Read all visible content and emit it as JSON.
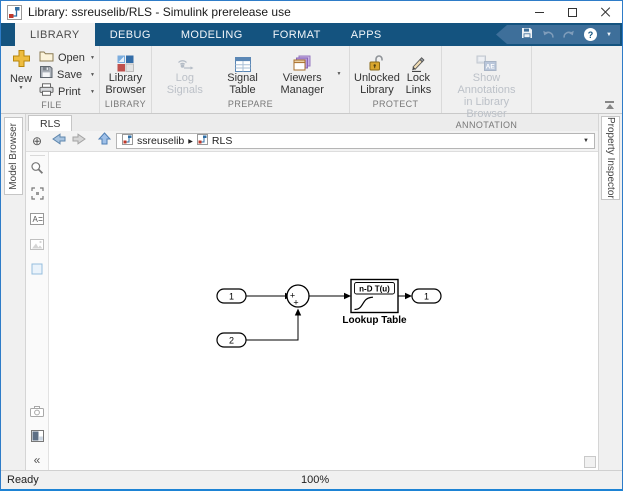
{
  "window": {
    "title": "Library: ssreuselib/RLS - Simulink prerelease use"
  },
  "tabs": [
    {
      "label": "LIBRARY",
      "active": true
    },
    {
      "label": "DEBUG"
    },
    {
      "label": "MODELING"
    },
    {
      "label": "FORMAT"
    },
    {
      "label": "APPS"
    }
  ],
  "ribbon": {
    "file": {
      "new_label": "New",
      "open_label": "Open",
      "save_label": "Save",
      "print_label": "Print",
      "section_label": "FILE"
    },
    "library": {
      "browser_label": "Library\nBrowser",
      "section_label": "LIBRARY"
    },
    "prepare": {
      "log_label": "Log\nSignals",
      "table_label": "Signal\nTable",
      "viewers_label": "Viewers\nManager",
      "section_label": "PREPARE"
    },
    "protect": {
      "unlocked_label": "Unlocked\nLibrary",
      "lock_label": "Lock\nLinks",
      "section_label": "PROTECT"
    },
    "annotation": {
      "show_label": "Show Annotations\nin Library Browser",
      "section_label": "ANNOTATION"
    }
  },
  "panels": {
    "left_tab": "Model Browser",
    "right_tab": "Property Inspector"
  },
  "doc": {
    "tab_label": "RLS",
    "breadcrumb": [
      {
        "label": "ssreuselib"
      },
      {
        "label": "RLS"
      }
    ]
  },
  "diagram": {
    "inport1_label": "1",
    "inport2_label": "2",
    "outport_label": "1",
    "sum_sign_left": "+",
    "sum_sign_bottom": "+",
    "lookup_icon_text": "n-D T(u)",
    "lookup_block_name": "Lookup Table"
  },
  "status": {
    "message": "Ready",
    "zoom_level": "100%"
  },
  "icons": {
    "dropdown": "▼",
    "breadcrumb_separator": "▶",
    "collapse_chevrons": "«",
    "pan_target": "⊕",
    "help": "?"
  },
  "colors": {
    "tabstrip_blue": "#14537f",
    "window_border_blue": "#2e7cc8",
    "ribbon_bg": "#f0f0f0",
    "disabled_text": "#bcc1c8",
    "gold_accent": "#eebc3f"
  }
}
